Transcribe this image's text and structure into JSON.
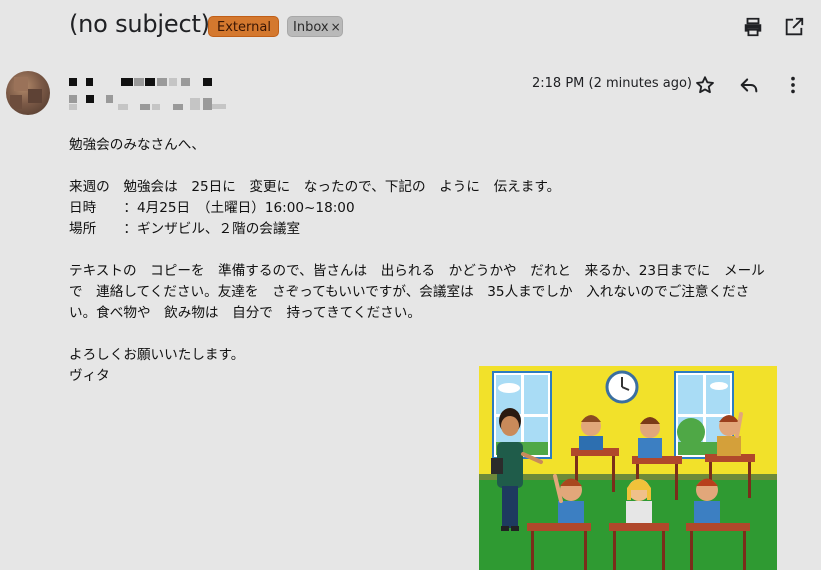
{
  "header": {
    "subject": "(no subject)",
    "labels": [
      {
        "text": "External",
        "color": "#d4782e"
      },
      {
        "text": "Inbox",
        "close": "×",
        "color": "#b9b9b9"
      }
    ],
    "icons": [
      "print-icon",
      "open-in-new-window-icon"
    ]
  },
  "message": {
    "time": "2:18 PM (2 minutes ago)",
    "actions": [
      "star-icon",
      "reply-icon",
      "more-vert-icon"
    ],
    "lines": [
      "勉強会のみなさんへ、",
      "",
      "来週の　勉強会は　25日に　変更に　なったので、下記の　ように　伝えます。",
      "日時　　：4月25日　（土曜日）16:00~18:00",
      "場所　　：ギンザビル、２階の会議室",
      "",
      "テキストの　コピーを　準備するので、皆さんは　出られる　かどうかや　だれと　来るか、23日までに　メール",
      "で　連絡してください。友達を　さぞってもいいですが、会議室は　35人までしか　入れないのでご注意くださ",
      "い。食べ物や　飲み物は　自分で　持ってきてください。",
      "",
      "よろしくお願いいたします。",
      "ヴィタ"
    ]
  },
  "colors": {
    "background": "#e6e6e6",
    "external_badge": "#d4782e",
    "inbox_badge": "#b9b9b9"
  }
}
